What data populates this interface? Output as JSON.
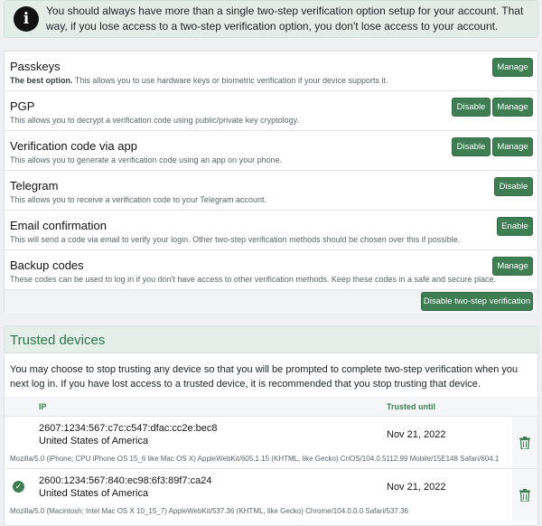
{
  "notice": {
    "icon": "info-icon",
    "text": "You should always have more than a single two-step verification option setup for your account. That way, if you lose access to a two-step verification option, you don't lose access to your account."
  },
  "methods": [
    {
      "title": "Passkeys",
      "desc_bold": "The best option.",
      "desc": " This allows you to use hardware keys or biometric verification if your device supports it.",
      "buttons": [
        "Manage"
      ]
    },
    {
      "title": "PGP",
      "desc_bold": "",
      "desc": "This allows you to decrypt a verification code using public/private key cryptology.",
      "buttons": [
        "Disable",
        "Manage"
      ]
    },
    {
      "title": "Verification code via app",
      "desc_bold": "",
      "desc": "This allows you to generate a verification code using an app on your phone.",
      "buttons": [
        "Disable",
        "Manage"
      ]
    },
    {
      "title": "Telegram",
      "desc_bold": "",
      "desc": "This allows you to receive a verification code to your Telegram account.",
      "buttons": [
        "Disable"
      ]
    },
    {
      "title": "Email confirmation",
      "desc_bold": "",
      "desc": "This will send a code via email to verify your login. Other two-step verification methods should be chosen over this if possible.",
      "buttons": [
        "Enable"
      ]
    },
    {
      "title": "Backup codes",
      "desc_bold": "",
      "desc": "These codes can be used to log in if you don't have access to other verification methods. Keep these codes in a safe and secure place.",
      "buttons": [
        "Manage"
      ]
    }
  ],
  "disable_all_label": "Disable two-step verification",
  "trusted": {
    "title": "Trusted devices",
    "description": "You may choose to stop trusting any device so that you will be prompted to complete two-step verification when you next log in. If you have lost access to a trusted device, it is recommended that you stop trusting that device.",
    "col_ip": "IP",
    "col_until": "Trusted until",
    "devices": [
      {
        "ip": "2607:1234:567:c7c:c547:dfac:cc2e:bec8",
        "country": "United States of America",
        "until": "Nov 21, 2022",
        "ua": "Mozilla/5.0 (iPhone; CPU iPhone OS 15_6 like Mac OS X) AppleWebKit/605.1.15 (KHTML, like Gecko) CriOS/104.0.5112.99 Mobile/15E148 Safari/604.1",
        "current": false
      },
      {
        "ip": "2600:1234:567:840:ec98:6f3:89f7:ca24",
        "country": "United States of America",
        "until": "Nov 21, 2022",
        "ua": "Mozilla/5.0 (Macintosh; Intel Mac OS X 10_15_7) AppleWebKit/537.36 (KHTML, like Gecko) Chrome/104.0.0.0 Safari/537.36",
        "current": true
      }
    ]
  },
  "colors": {
    "accent": "#3e7e52",
    "header_bg": "#e5efe9",
    "notice_bg": "#e3ede8"
  }
}
